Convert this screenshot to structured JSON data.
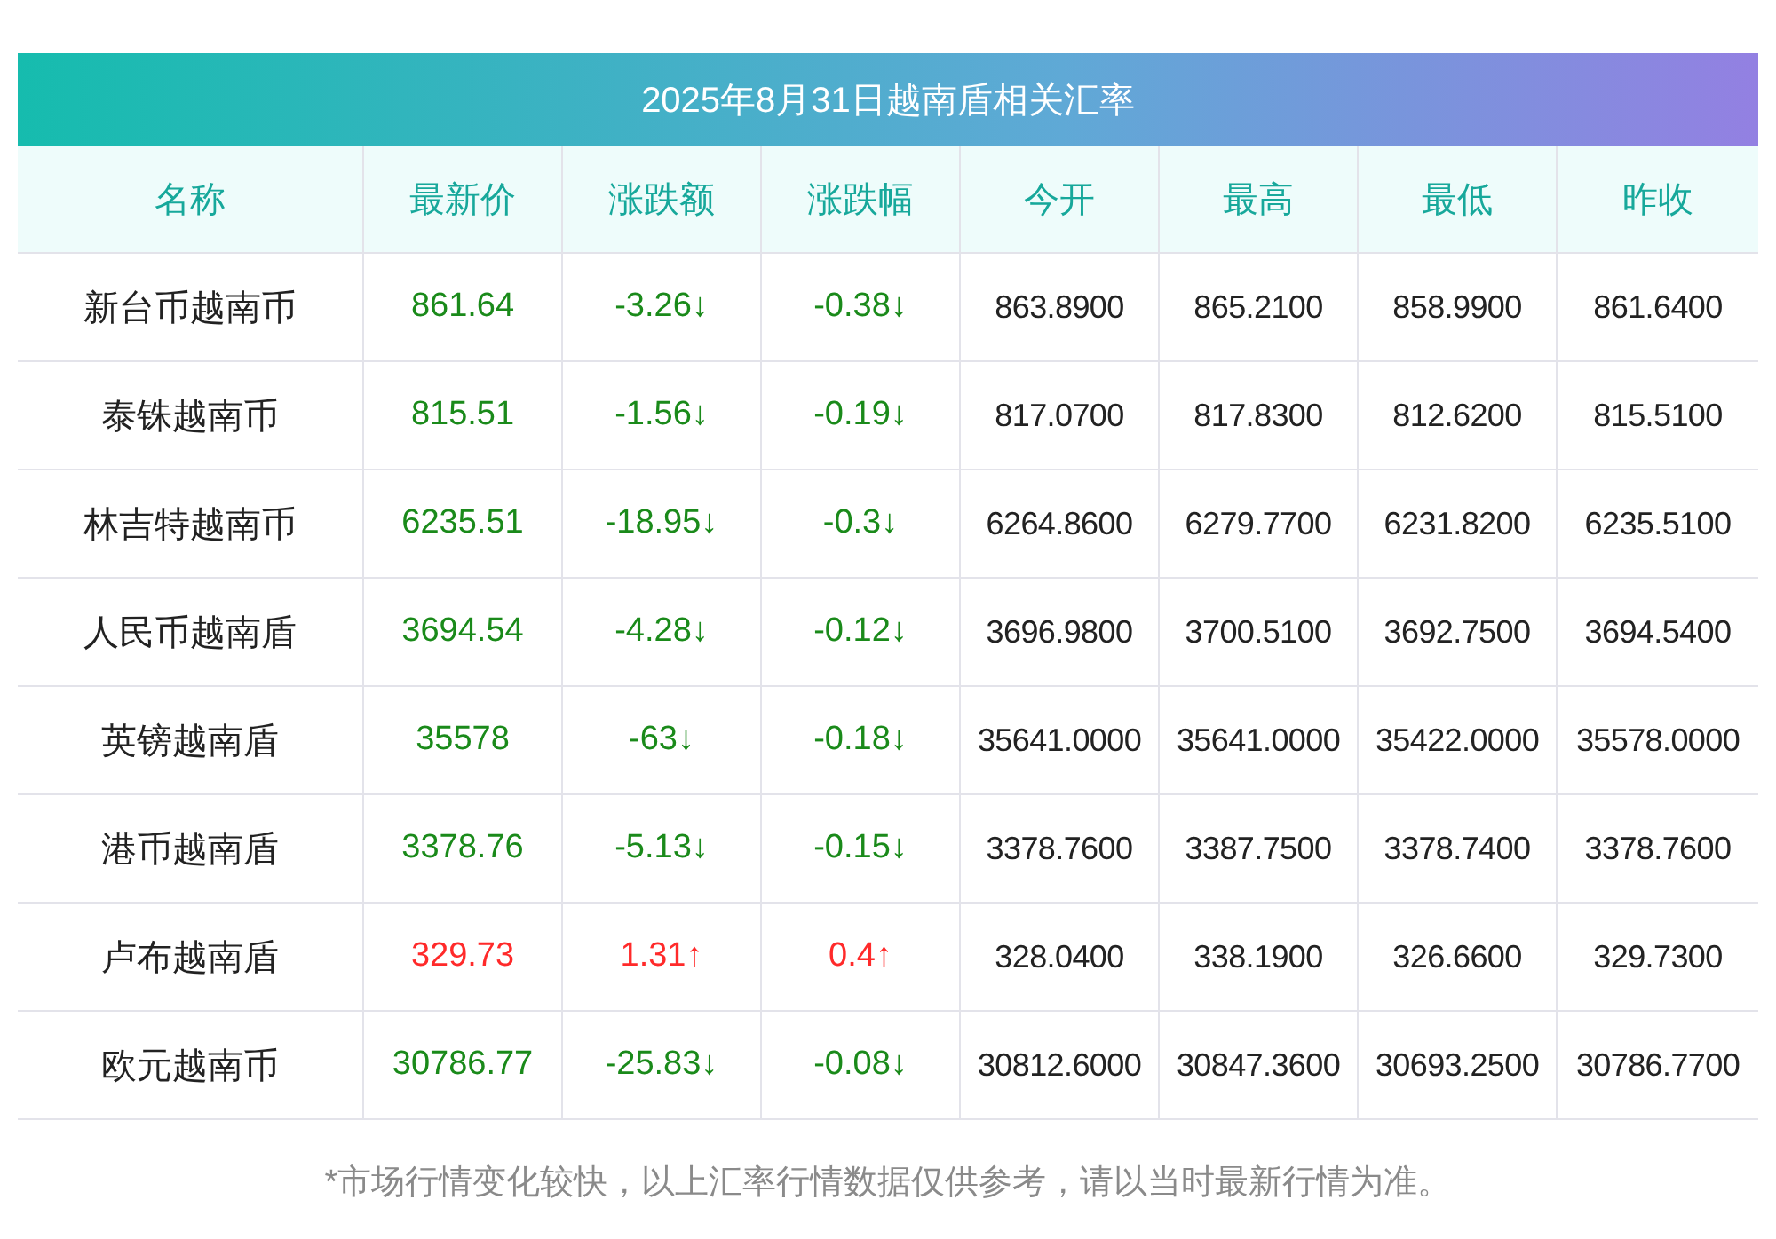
{
  "title": "2025年8月31日越南盾相关汇率",
  "columns": [
    "名称",
    "最新价",
    "涨跌额",
    "涨跌幅",
    "今开",
    "最高",
    "最低",
    "昨收"
  ],
  "rows": [
    {
      "name": "新台币越南币",
      "color": "#1a8a1a",
      "price": "861.64",
      "change": "-3.26↓",
      "change_pct": "-0.38↓",
      "open": "863.8900",
      "high": "865.2100",
      "low": "858.9900",
      "prev_close": "861.6400"
    },
    {
      "name": "泰铢越南币",
      "color": "#1a8a1a",
      "price": "815.51",
      "change": "-1.56↓",
      "change_pct": "-0.19↓",
      "open": "817.0700",
      "high": "817.8300",
      "low": "812.6200",
      "prev_close": "815.5100"
    },
    {
      "name": "林吉特越南币",
      "color": "#1a8a1a",
      "price": "6235.51",
      "change": "-18.95↓",
      "change_pct": "-0.3↓",
      "open": "6264.8600",
      "high": "6279.7700",
      "low": "6231.8200",
      "prev_close": "6235.5100"
    },
    {
      "name": "人民币越南盾",
      "color": "#1a8a1a",
      "price": "3694.54",
      "change": "-4.28↓",
      "change_pct": "-0.12↓",
      "open": "3696.9800",
      "high": "3700.5100",
      "low": "3692.7500",
      "prev_close": "3694.5400"
    },
    {
      "name": "英镑越南盾",
      "color": "#1a8a1a",
      "price": "35578",
      "change": "-63↓",
      "change_pct": "-0.18↓",
      "open": "35641.0000",
      "high": "35641.0000",
      "low": "35422.0000",
      "prev_close": "35578.0000"
    },
    {
      "name": "港币越南盾",
      "color": "#1a8a1a",
      "price": "3378.76",
      "change": "-5.13↓",
      "change_pct": "-0.15↓",
      "open": "3378.7600",
      "high": "3387.7500",
      "low": "3378.7400",
      "prev_close": "3378.7600"
    },
    {
      "name": "卢布越南盾",
      "color": "#ff2a2a",
      "price": "329.73",
      "change": "1.31↑",
      "change_pct": "0.4↑",
      "open": "328.0400",
      "high": "338.1900",
      "low": "326.6600",
      "prev_close": "329.7300"
    },
    {
      "name": "欧元越南币",
      "color": "#1a8a1a",
      "price": "30786.77",
      "change": "-25.83↓",
      "change_pct": "-0.08↓",
      "open": "30812.6000",
      "high": "30847.3600",
      "low": "30693.2500",
      "prev_close": "30786.7700"
    }
  ],
  "note": "*市场行情变化较快，以上汇率行情数据仅供参考，请以当时最新行情为准。"
}
